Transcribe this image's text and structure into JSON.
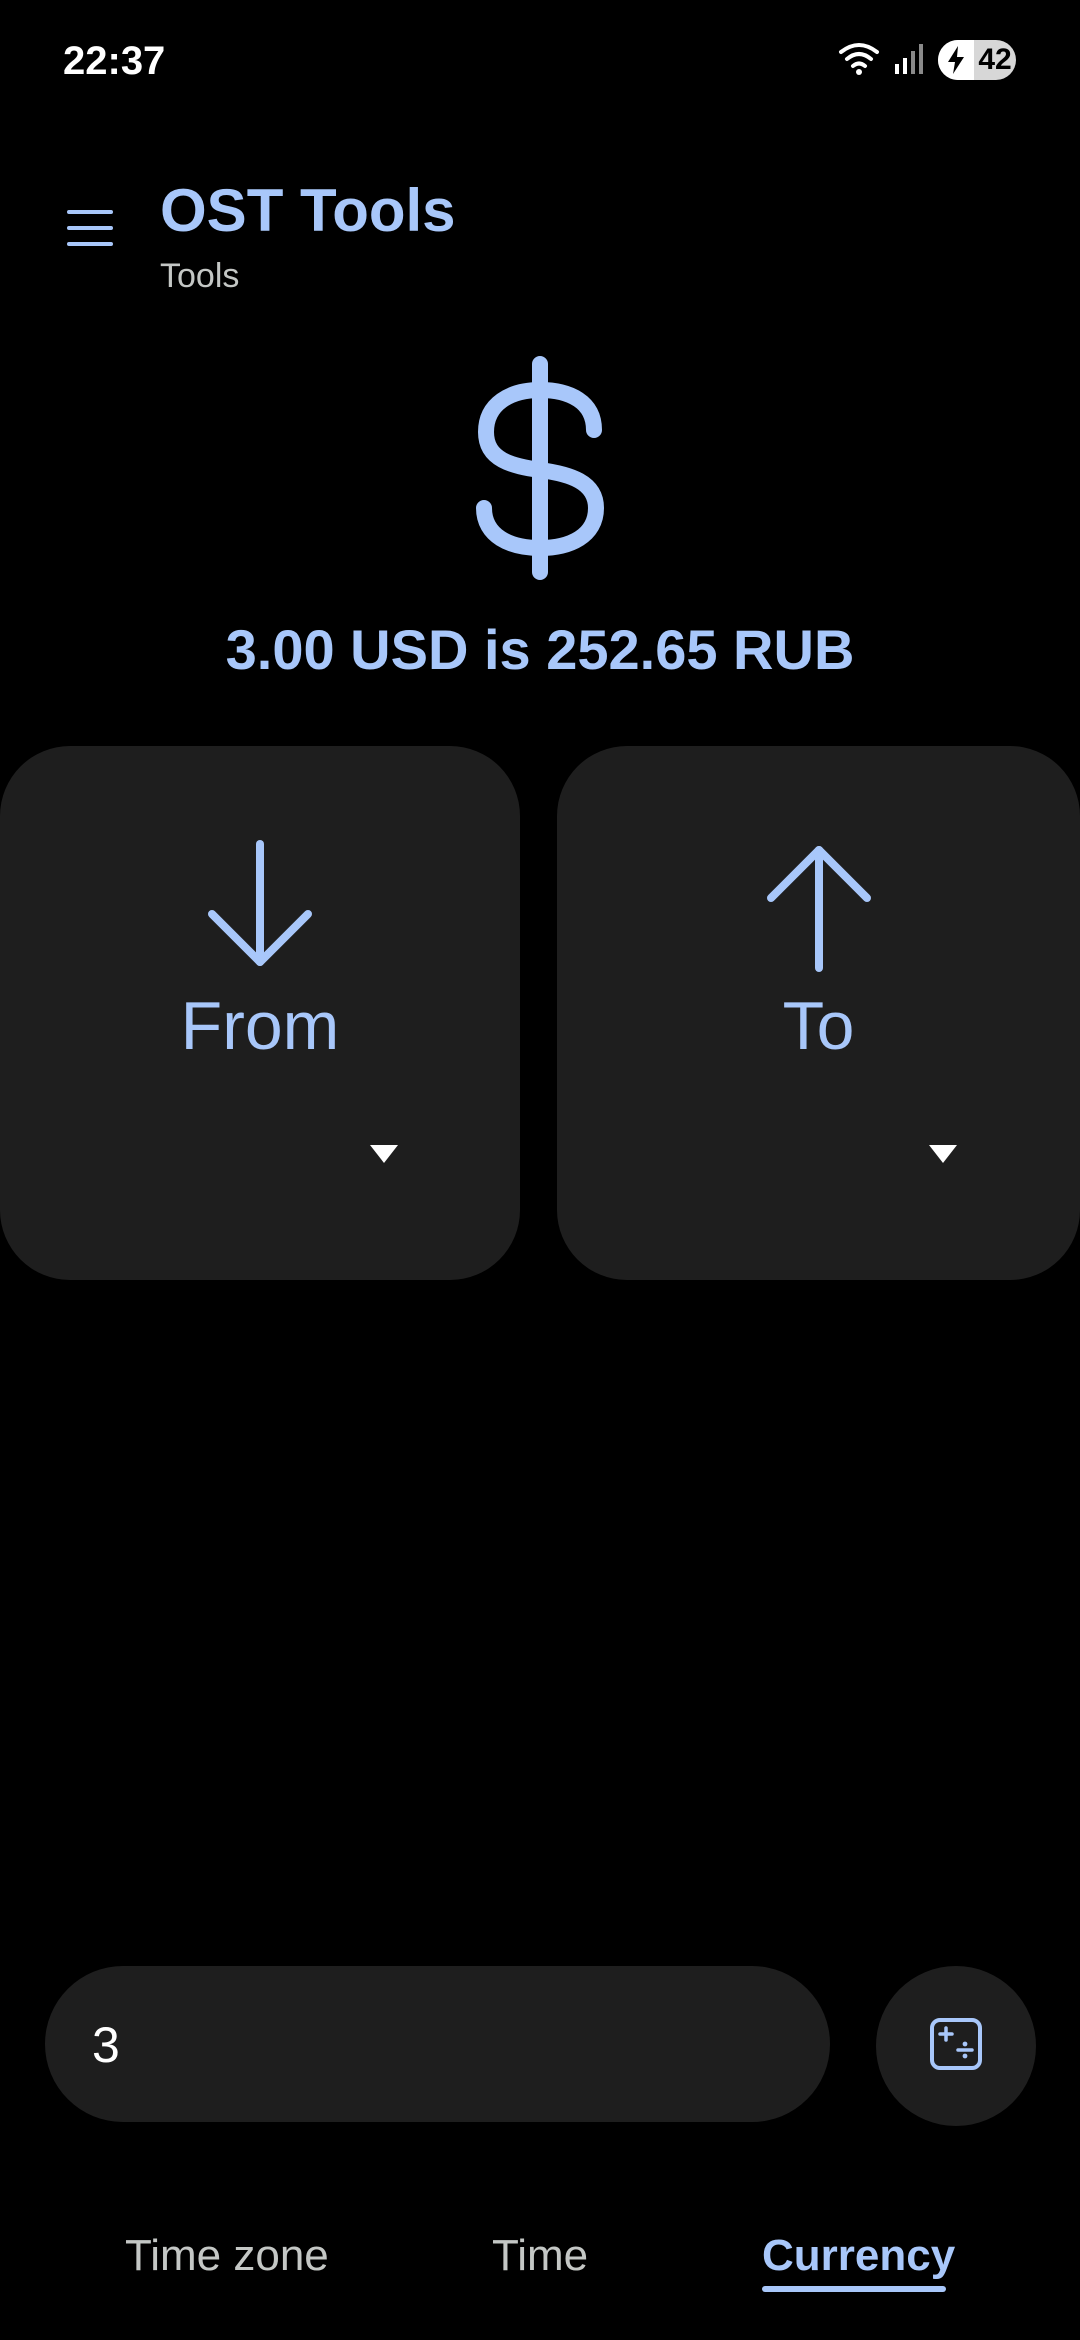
{
  "status_bar": {
    "time": "22:37",
    "battery_level": "42",
    "icons": [
      "wifi-icon",
      "signal-icon",
      "battery-charging-icon"
    ]
  },
  "header": {
    "title": "OST Tools",
    "subtitle": "Tools",
    "menu_icon": "hamburger-menu-icon"
  },
  "hero": {
    "icon": "dollar-icon",
    "result": "3.00 USD is 252.65 RUB"
  },
  "cards": {
    "from": {
      "label": "From",
      "icon": "arrow-down-icon"
    },
    "to": {
      "label": "To",
      "icon": "arrow-up-icon"
    }
  },
  "input": {
    "value": "3",
    "calculator_icon": "calculator-icon"
  },
  "tabs": [
    {
      "label": "Time zone",
      "active": false
    },
    {
      "label": "Time",
      "active": false
    },
    {
      "label": "Currency",
      "active": true
    }
  ],
  "colors": {
    "background": "#000000",
    "accent": "#a8c7fa",
    "surface": "#1e1e1e",
    "muted_text": "#c4c7c5"
  }
}
